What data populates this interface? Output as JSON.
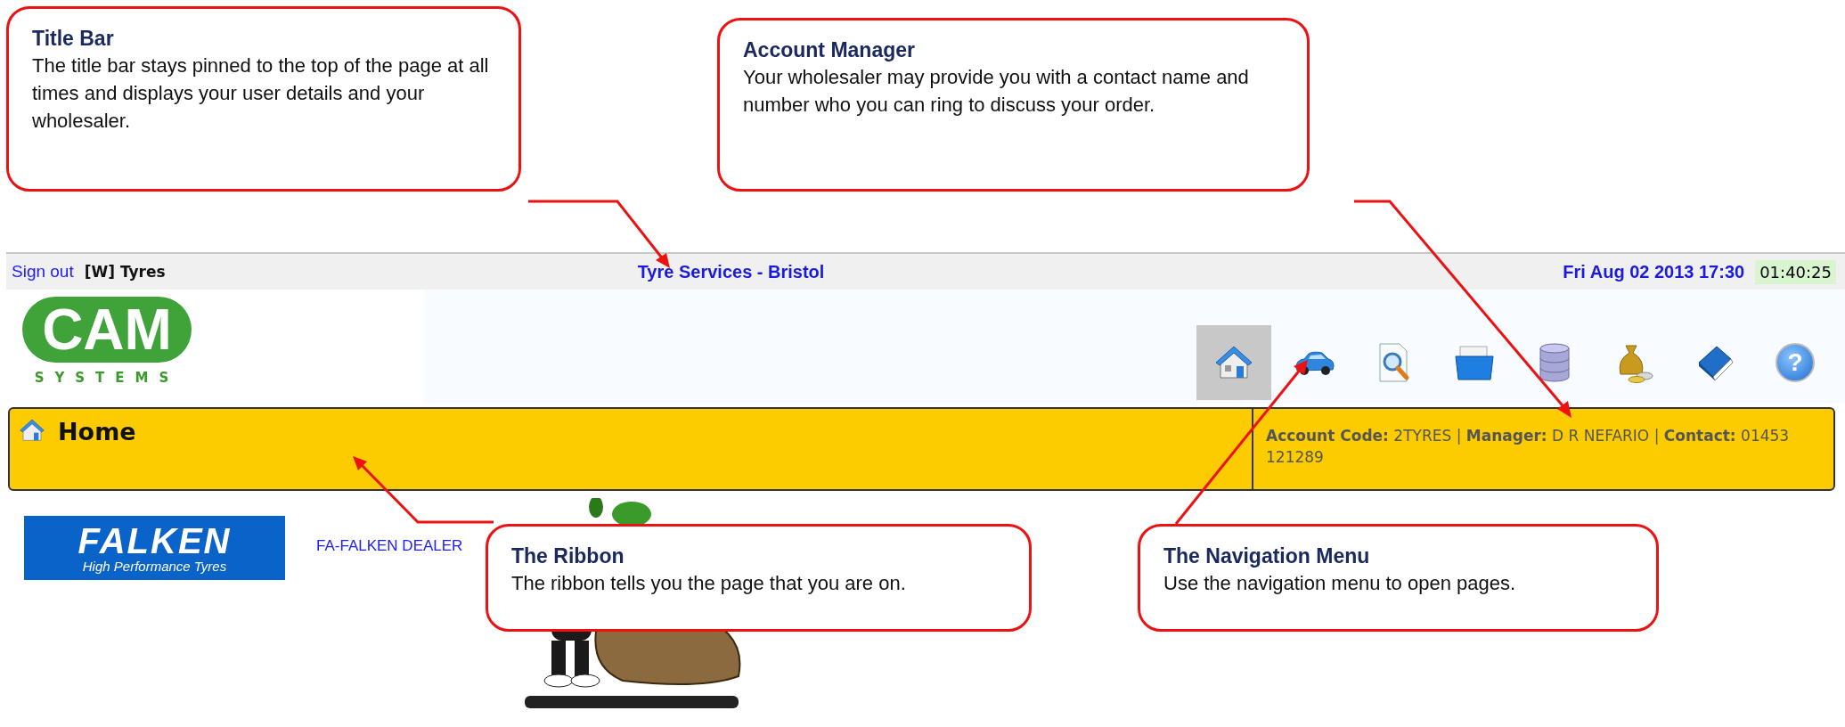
{
  "title_bar": {
    "sign_out": "Sign out",
    "user": "[W] Tyres",
    "wholesaler": "Tyre Services - Bristol",
    "datetime": "Fri Aug 02 2013 17:30",
    "timer": "01:40:25"
  },
  "logo": {
    "name": "CAM",
    "tagline": "SYSTEMS"
  },
  "nav_menu": [
    {
      "kind": "home",
      "selected": true
    },
    {
      "kind": "car",
      "selected": false
    },
    {
      "kind": "search-document",
      "selected": false
    },
    {
      "kind": "box",
      "selected": false
    },
    {
      "kind": "database",
      "selected": false
    },
    {
      "kind": "money",
      "selected": false
    },
    {
      "kind": "book",
      "selected": false
    },
    {
      "kind": "help",
      "label": "?",
      "selected": false
    }
  ],
  "ribbon": {
    "title": "Home",
    "account_info": "**Account Code:** 2TYRES | **Manager:** D R NEFARIO | **Contact:** 01453 121289"
  },
  "dealer": {
    "brand": "FALKEN",
    "brand_tagline": "High Performance Tyres",
    "link": "FA-FALKEN DEALER"
  },
  "callouts": [
    {
      "title": "Title Bar",
      "text": "The title bar stays pinned to the top of the page at all times and displays your user details and your wholesaler."
    },
    {
      "title": "Account Manager",
      "text": "Your wholesaler may provide you with a contact name and number who you can ring to discuss your order."
    },
    {
      "title": "The Ribbon",
      "text": "The ribbon tells you the page that you are on."
    },
    {
      "title": "The Navigation Menu",
      "text": "Use the navigation menu to open pages."
    }
  ]
}
